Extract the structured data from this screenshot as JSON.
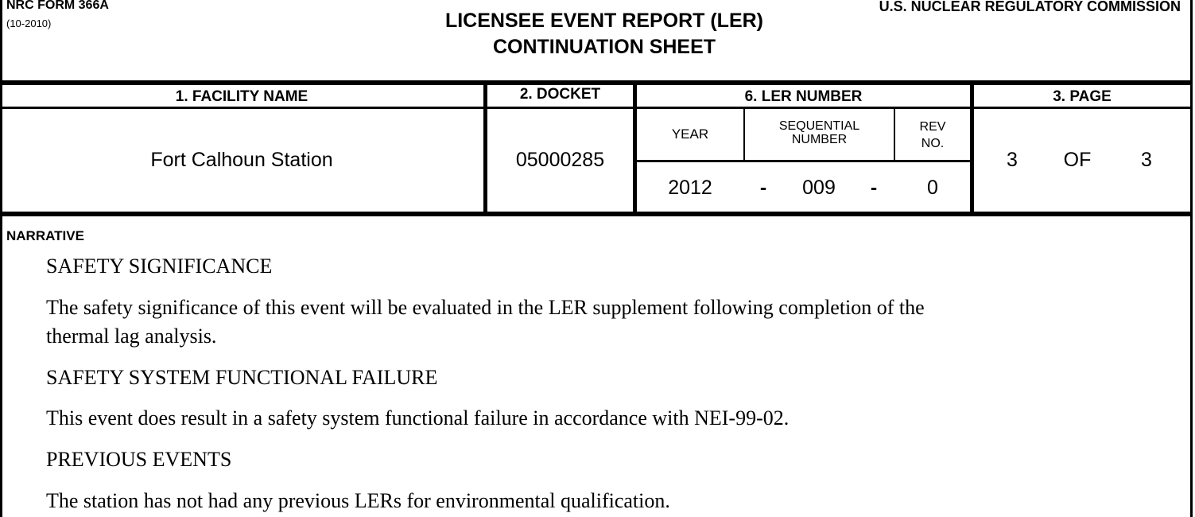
{
  "header": {
    "form_number": "NRC FORM 366A",
    "form_date": "(10-2010)",
    "agency": "U.S. NUCLEAR REGULATORY COMMISSION",
    "title_line1": "LICENSEE EVENT REPORT (LER)",
    "title_line2": "CONTINUATION SHEET"
  },
  "table": {
    "facility_header": "1. FACILITY NAME",
    "docket_header": "2. DOCKET",
    "ler_header": "6. LER NUMBER",
    "page_header": "3. PAGE",
    "year_label": "YEAR",
    "sequential_label_1": "SEQUENTIAL",
    "sequential_label_2": "NUMBER",
    "rev_label_1": "REV",
    "rev_label_2": "NO.",
    "facility_name": "Fort Calhoun Station",
    "docket": "05000285",
    "year": "2012",
    "dash": "-",
    "sequential": "009",
    "rev": "0",
    "page_current": "3",
    "page_of": "OF",
    "page_total": "3"
  },
  "narrative": {
    "label": "NARRATIVE",
    "heading1": "SAFETY SIGNIFICANCE",
    "para1_line1": "The safety significance of this event will be evaluated in the LER supplement following completion of the",
    "para1_line2": "thermal lag analysis.",
    "heading2": "SAFETY SYSTEM FUNCTIONAL FAILURE",
    "para2": "This event does result in a safety system functional failure in accordance with NEI-99-02.",
    "heading3": "PREVIOUS EVENTS",
    "para3": "The station has not had any previous LERs for environmental qualification."
  }
}
